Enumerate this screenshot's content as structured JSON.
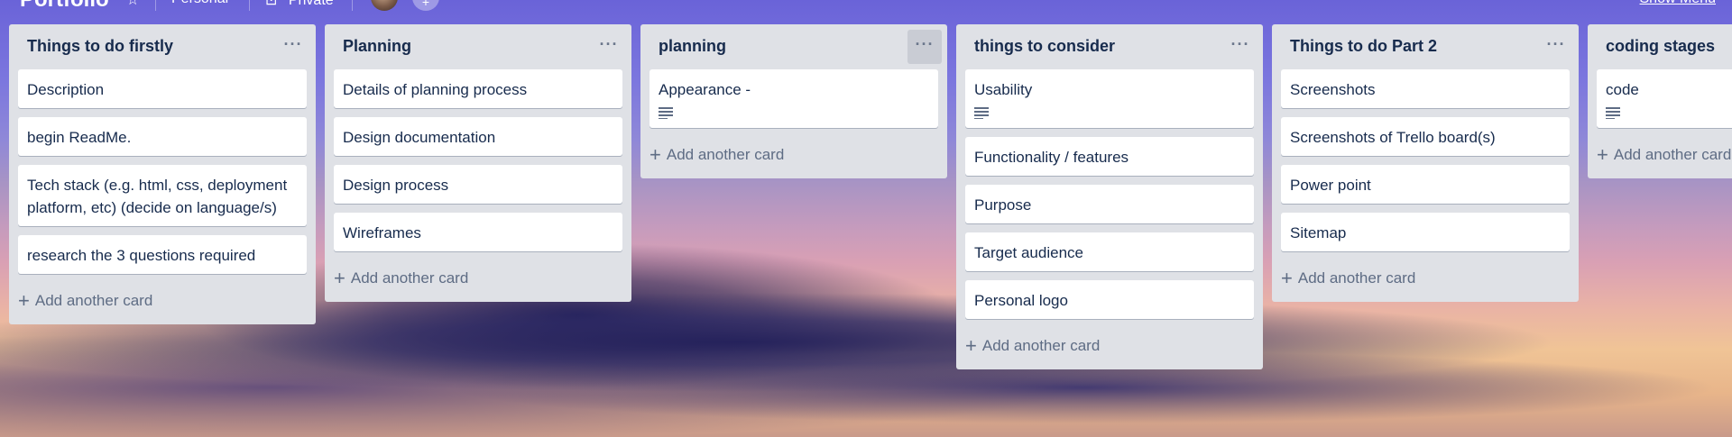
{
  "header": {
    "board_title": "Portfolio",
    "star_icon": "star-icon",
    "team_label": "Personal",
    "visibility_label": "Private",
    "show_menu_label": "Show Menu"
  },
  "lists": [
    {
      "title": "Things to do firstly",
      "menu_icon": "···",
      "cards": [
        {
          "text": "Description",
          "has_description": false
        },
        {
          "text": "begin ReadMe.",
          "has_description": false
        },
        {
          "text": "Tech stack (e.g. html, css, deployment platform, etc) (decide on language/s)",
          "has_description": false
        },
        {
          "text": "research the 3 questions required",
          "has_description": false
        }
      ],
      "add_label": "Add another card"
    },
    {
      "title": "Planning",
      "menu_icon": "···",
      "cards": [
        {
          "text": "Details of planning process",
          "has_description": false
        },
        {
          "text": "Design documentation",
          "has_description": false
        },
        {
          "text": "Design process",
          "has_description": false
        },
        {
          "text": "Wireframes",
          "has_description": false
        }
      ],
      "add_label": "Add another card"
    },
    {
      "title": "planning",
      "menu_icon": "···",
      "cards": [
        {
          "text": "Appearance -",
          "has_description": true
        }
      ],
      "add_label": "Add another card"
    },
    {
      "title": "things to consider",
      "menu_icon": "···",
      "cards": [
        {
          "text": "Usability",
          "has_description": true
        },
        {
          "text": "Functionality / features",
          "has_description": false
        },
        {
          "text": "Purpose",
          "has_description": false
        },
        {
          "text": "Target audience",
          "has_description": false
        },
        {
          "text": "Personal logo",
          "has_description": false
        }
      ],
      "add_label": "Add another card"
    },
    {
      "title": "Things to do Part 2",
      "menu_icon": "···",
      "cards": [
        {
          "text": "Screenshots",
          "has_description": false
        },
        {
          "text": "Screenshots of Trello board(s)",
          "has_description": false
        },
        {
          "text": "Power point",
          "has_description": false
        },
        {
          "text": "Sitemap",
          "has_description": false
        }
      ],
      "add_label": "Add another card"
    },
    {
      "title": "coding stages",
      "menu_icon": "···",
      "cards": [
        {
          "text": "code",
          "has_description": true
        }
      ],
      "add_label": "Add another card"
    }
  ]
}
